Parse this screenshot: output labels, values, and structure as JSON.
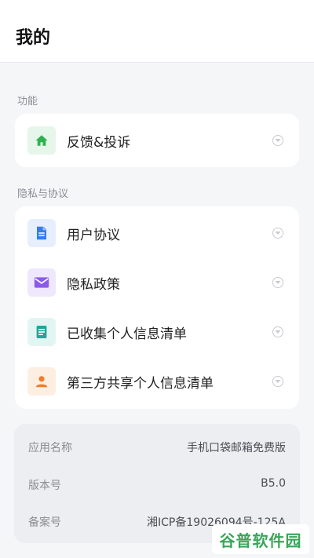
{
  "header": {
    "title": "我的"
  },
  "sections": {
    "function_label": "功能",
    "privacy_label": "隐私与协议"
  },
  "function_items": [
    {
      "label": "反馈&投诉",
      "icon": "home-icon",
      "color": "#2db24f",
      "bg": "#e6f6ea"
    }
  ],
  "privacy_items": [
    {
      "label": "用户协议",
      "icon": "document-icon",
      "color": "#3a7bea",
      "bg": "#e7effd"
    },
    {
      "label": "隐私政策",
      "icon": "mail-icon",
      "color": "#8a5ce6",
      "bg": "#efe8fc"
    },
    {
      "label": "已收集个人信息清单",
      "icon": "note-icon",
      "color": "#22a59a",
      "bg": "#e3f5f3"
    },
    {
      "label": "第三方共享个人信息清单",
      "icon": "person-icon",
      "color": "#ef7d2a",
      "bg": "#fdeee2"
    }
  ],
  "app_info": [
    {
      "key": "应用名称",
      "value": "手机口袋邮箱免费版"
    },
    {
      "key": "版本号",
      "value": "B5.0"
    },
    {
      "key": "备案号",
      "value": "湘ICP备19026094号-125A"
    }
  ],
  "watermark": {
    "text": "谷普软件园"
  }
}
